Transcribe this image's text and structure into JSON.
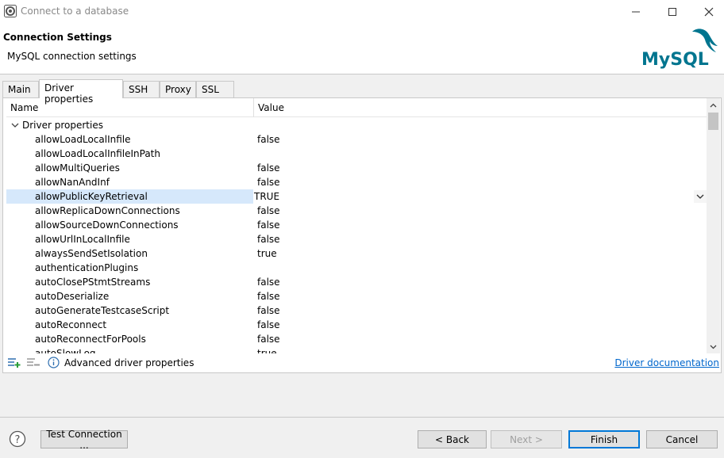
{
  "window": {
    "title": "Connect to a database"
  },
  "header": {
    "title": "Connection Settings",
    "subtitle": "MySQL connection settings",
    "logo_text": "MySQL"
  },
  "tabs": [
    "Main",
    "Driver properties",
    "SSH",
    "Proxy",
    "SSL"
  ],
  "active_tab": "Driver properties",
  "table": {
    "columns": [
      "Name",
      "Value"
    ],
    "group": "Driver properties",
    "rows": [
      {
        "name": "allowLoadLocalInfile",
        "value": "false"
      },
      {
        "name": "allowLoadLocalInfileInPath",
        "value": ""
      },
      {
        "name": "allowMultiQueries",
        "value": "false"
      },
      {
        "name": "allowNanAndInf",
        "value": "false"
      },
      {
        "name": "allowPublicKeyRetrieval",
        "value": "TRUE",
        "selected": true
      },
      {
        "name": "allowReplicaDownConnections",
        "value": "false"
      },
      {
        "name": "allowSourceDownConnections",
        "value": "false"
      },
      {
        "name": "allowUrlInLocalInfile",
        "value": "false"
      },
      {
        "name": "alwaysSendSetIsolation",
        "value": "true"
      },
      {
        "name": "authenticationPlugins",
        "value": ""
      },
      {
        "name": "autoClosePStmtStreams",
        "value": "false"
      },
      {
        "name": "autoDeserialize",
        "value": "false"
      },
      {
        "name": "autoGenerateTestcaseScript",
        "value": "false"
      },
      {
        "name": "autoReconnect",
        "value": "false"
      },
      {
        "name": "autoReconnectForPools",
        "value": "false"
      },
      {
        "name": "autoSlowLog",
        "value": "true"
      }
    ]
  },
  "footer": {
    "advanced_label": "Advanced driver properties",
    "doc_link": "Driver documentation"
  },
  "buttons": {
    "test": "Test Connection ...",
    "back": "< Back",
    "next": "Next >",
    "finish": "Finish",
    "cancel": "Cancel"
  },
  "colors": {
    "selection": "#d6e8fb",
    "link": "#0066cc",
    "logo_teal": "#00758f",
    "logo_orange": "#f29111"
  }
}
